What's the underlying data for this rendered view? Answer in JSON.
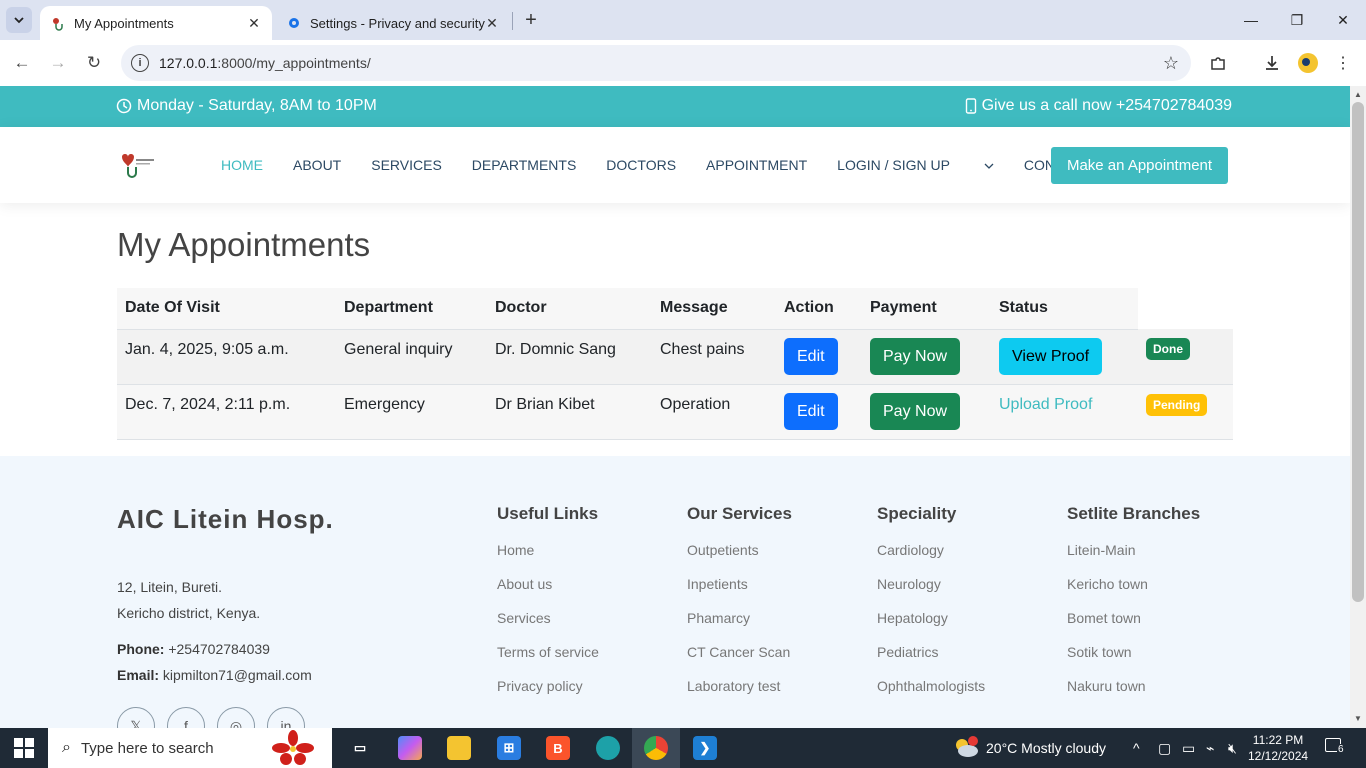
{
  "browser": {
    "tabs": [
      {
        "title": "My Appointments",
        "active": true
      },
      {
        "title": "Settings - Privacy and security",
        "active": false
      }
    ],
    "url_host": "127.0.0.1",
    "url_path": ":8000/my_appointments/"
  },
  "topbar": {
    "hours": "Monday - Saturday, 8AM to 10PM",
    "call": "Give us a call now +254702784039"
  },
  "nav": {
    "items": [
      "HOME",
      "ABOUT",
      "SERVICES",
      "DEPARTMENTS",
      "DOCTORS",
      "APPOINTMENT",
      "LOGIN / SIGN UP",
      "CONTACT US"
    ],
    "cta": "Make an Appointment"
  },
  "page": {
    "title": "My Appointments"
  },
  "table": {
    "headers": [
      "Date Of Visit",
      "Department",
      "Doctor",
      "Message",
      "Action",
      "Payment",
      "Status"
    ],
    "rows": [
      {
        "date": "Jan. 4, 2025, 9:05 a.m.",
        "department": "General inquiry",
        "doctor": "Dr. Domnic Sang",
        "message": "Chest pains",
        "action": "Edit",
        "payment": "Pay Now",
        "proof": "View Proof",
        "status": "Done"
      },
      {
        "date": "Dec. 7, 2024, 2:11 p.m.",
        "department": "Emergency",
        "doctor": "Dr Brian Kibet",
        "message": "Operation",
        "action": "Edit",
        "payment": "Pay Now",
        "proof": "Upload Proof",
        "status": "Pending"
      }
    ]
  },
  "footer": {
    "title": "AIC Litein Hosp.",
    "address1": "12, Litein, Bureti.",
    "address2": "Kericho district, Kenya.",
    "phone_label": "Phone:",
    "phone": "+254702784039",
    "email_label": "Email:",
    "email": "kipmilton71@gmail.com",
    "columns": [
      {
        "title": "Useful Links",
        "items": [
          "Home",
          "About us",
          "Services",
          "Terms of service",
          "Privacy policy"
        ]
      },
      {
        "title": "Our Services",
        "items": [
          "Outpetients",
          "Inpetients",
          "Phamarcy",
          "CT Cancer Scan",
          "Laboratory test"
        ]
      },
      {
        "title": "Speciality",
        "items": [
          "Cardiology",
          "Neurology",
          "Hepatology",
          "Pediatrics",
          "Ophthalmologists"
        ]
      },
      {
        "title": "Setlite Branches",
        "items": [
          "Litein-Main",
          "Kericho town",
          "Bomet town",
          "Sotik town",
          "Nakuru town"
        ]
      }
    ]
  },
  "taskbar": {
    "search_placeholder": "Type here to search",
    "weather": "20°C  Mostly cloudy",
    "time": "11:22 PM",
    "date": "12/12/2024",
    "notif_count": "6"
  },
  "colors": {
    "accent": "#3fbbc0",
    "edit": "#0d6efd",
    "pay": "#198754",
    "proof": "#0dcaf0",
    "pending": "#ffc107"
  }
}
